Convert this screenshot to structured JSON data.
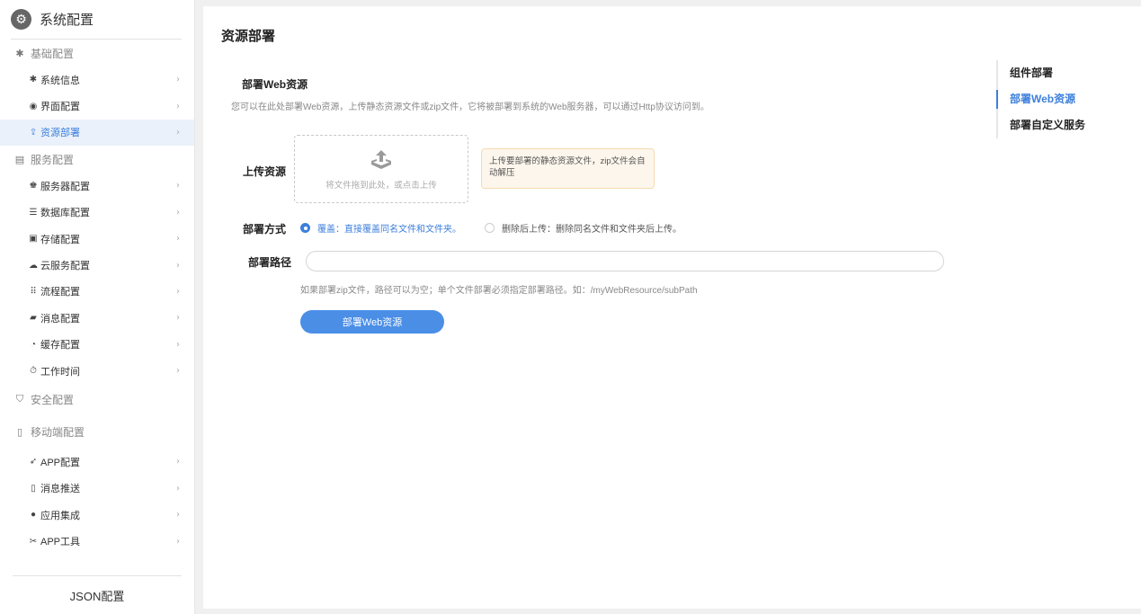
{
  "sidebar": {
    "title": "系统配置",
    "groups": [
      {
        "label": "基础配置",
        "icon": "gear-icon",
        "items": [
          {
            "label": "系统信息",
            "icon": "gear-icon"
          },
          {
            "label": "界面配置",
            "icon": "palette-icon"
          },
          {
            "label": "资源部署",
            "icon": "deploy-icon",
            "active": true
          }
        ]
      },
      {
        "label": "服务配置",
        "icon": "server-group-icon",
        "items": [
          {
            "label": "服务器配置",
            "icon": "server-icon"
          },
          {
            "label": "数据库配置",
            "icon": "database-icon"
          },
          {
            "label": "存储配置",
            "icon": "storage-icon"
          },
          {
            "label": "云服务配置",
            "icon": "cloud-icon"
          },
          {
            "label": "流程配置",
            "icon": "flow-icon"
          },
          {
            "label": "消息配置",
            "icon": "message-icon"
          },
          {
            "label": "缓存配置",
            "icon": "cache-icon"
          },
          {
            "label": "工作时间",
            "icon": "timer-icon"
          }
        ]
      },
      {
        "label": "安全配置",
        "icon": "shield-icon",
        "items": []
      },
      {
        "label": "移动端配置",
        "icon": "mobile-icon",
        "items": [
          {
            "label": "APP配置",
            "icon": "rocket-icon"
          },
          {
            "label": "消息推送",
            "icon": "push-icon"
          },
          {
            "label": "应用集成",
            "icon": "integration-icon"
          },
          {
            "label": "APP工具",
            "icon": "tools-icon"
          }
        ]
      }
    ],
    "footer": "JSON配置"
  },
  "main": {
    "page_title": "资源部署",
    "section_title": "部署Web资源",
    "section_desc": "您可以在此处部署Web资源，上传静态资源文件或zip文件，它将被部署到系统的Web服务器，可以通过Http协议访问到。",
    "upload": {
      "label": "上传资源",
      "drop_text": "将文件拖到此处，或点击上传",
      "tip": "上传要部署的静态资源文件，zip文件会自动解压"
    },
    "mode": {
      "label": "部署方式",
      "options": [
        {
          "label": "覆盖：直接覆盖同名文件和文件夹。",
          "checked": true
        },
        {
          "label": "删除后上传：删除同名文件和文件夹后上传。",
          "checked": false
        }
      ]
    },
    "path": {
      "label": "部署路径",
      "value": "",
      "placeholder": "",
      "hint": "如果部署zip文件，路径可以为空；单个文件部署必须指定部署路径。如：/myWebResource/subPath"
    },
    "deploy_button": "部署Web资源"
  },
  "anchor_nav": [
    {
      "label": "组件部署",
      "active": false
    },
    {
      "label": "部署Web资源",
      "active": true
    },
    {
      "label": "部署自定义服务",
      "active": false
    }
  ],
  "colors": {
    "accent": "#3d7fdb",
    "button": "#4a8ee6",
    "tip_background": "#fdf6ec"
  }
}
